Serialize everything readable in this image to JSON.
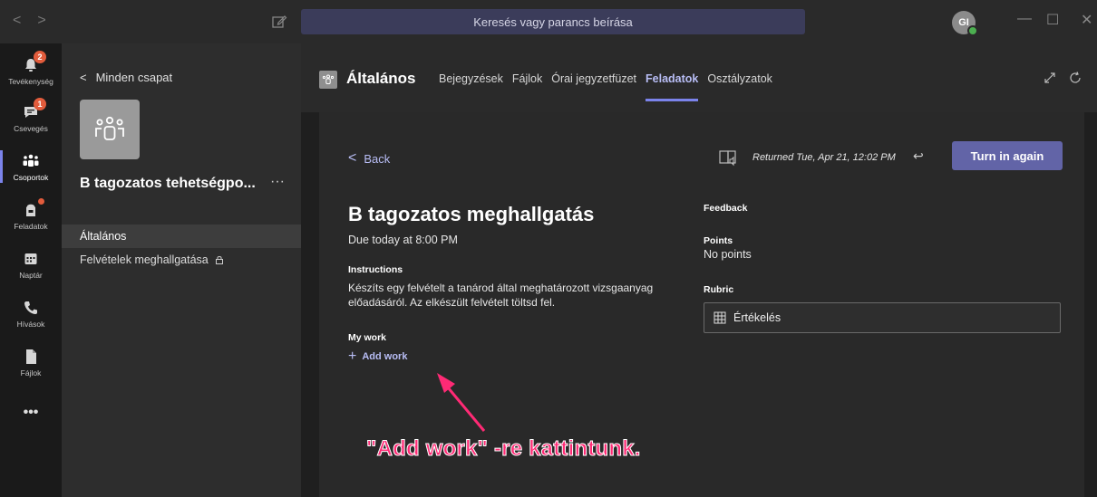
{
  "titlebar": {
    "search_placeholder": "Keresés vagy parancs beírása",
    "avatar_initials": "GI",
    "minimize": "—",
    "maximize": "☐",
    "close": "✕",
    "back": "<",
    "forward": ">"
  },
  "rail": {
    "items": [
      {
        "label": "Tevékenység",
        "badge": "2"
      },
      {
        "label": "Csevegés",
        "badge": "1"
      },
      {
        "label": "Csoportok"
      },
      {
        "label": "Feladatok"
      },
      {
        "label": "Naptár"
      },
      {
        "label": "Hívások"
      },
      {
        "label": "Fájlok"
      },
      {
        "label": "•••"
      }
    ]
  },
  "team": {
    "back_label": "Minden csapat",
    "name": "B tagozatos tehetségpo...",
    "more": "···",
    "channels": [
      {
        "label": "Általános"
      },
      {
        "label": "Felvételek meghallgatása"
      }
    ]
  },
  "header": {
    "channel_name": "Általános",
    "tabs": [
      "Bejegyzések",
      "Fájlok",
      "Órai jegyzetfüzet",
      "Feladatok",
      "Osztályzatok"
    ],
    "active_tab": "Feladatok"
  },
  "assignment": {
    "back_label": "Back",
    "returned": "Returned Tue, Apr 21, 12:02 PM",
    "turn_in_label": "Turn in again",
    "title": "B tagozatos meghallgatás",
    "due": "Due today at 8:00 PM",
    "instructions_label": "Instructions",
    "instructions_text": "Készíts egy felvételt a tanárod által meghatározott vizsgaanyag előadásáról. Az elkészült felvételt töltsd fel.",
    "my_work_label": "My work",
    "add_work_label": "Add work",
    "feedback_label": "Feedback",
    "points_label": "Points",
    "points_value": "No points",
    "rubric_label": "Rubric",
    "rubric_item": "Értékelés"
  },
  "annotation": {
    "text": "\"Add work\" -re kattintunk.",
    "color": "#ff2a75"
  }
}
